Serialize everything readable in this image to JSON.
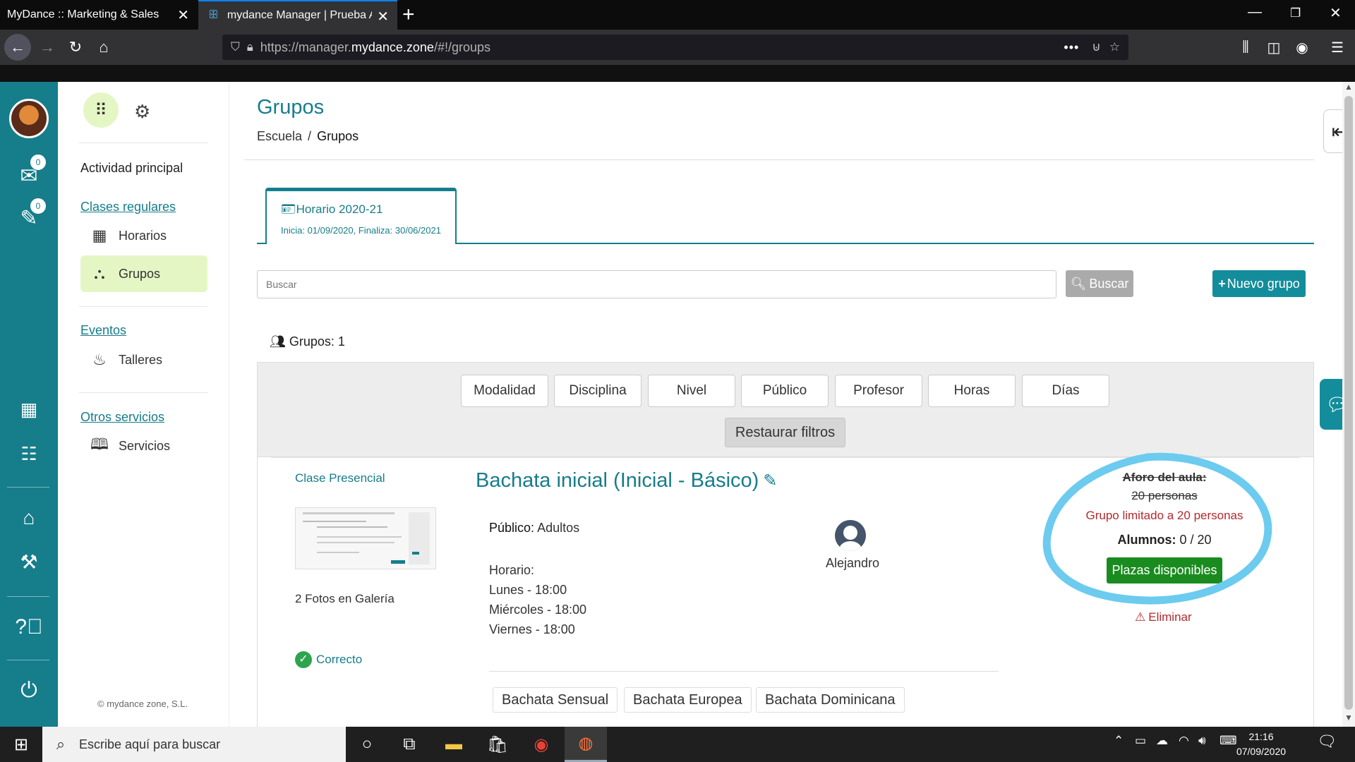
{
  "browser": {
    "tabs": [
      {
        "title": "MyDance :: Marketing & Sales"
      },
      {
        "title": "mydance Manager | Prueba Ale"
      }
    ],
    "url_prefix": "https://manager.",
    "url_domain": "mydance.zone",
    "url_path": "/#!/groups",
    "page_actions": "•••"
  },
  "rail": {
    "messages_badge": "0",
    "tasks_badge": "0"
  },
  "sidebar": {
    "main_heading": "Actividad principal",
    "sections": [
      {
        "title": "Clases regulares",
        "items": [
          "Horarios",
          "Grupos"
        ]
      },
      {
        "title": "Eventos",
        "items": [
          "Talleres"
        ]
      },
      {
        "title": "Otros servicios",
        "items": [
          "Servicios"
        ]
      }
    ],
    "copyright": "© mydance zone, S.L."
  },
  "header": {
    "title": "Grupos",
    "breadcrumb": {
      "root": "Escuela",
      "separator": "/",
      "current": "Grupos"
    }
  },
  "season_tab": {
    "title": "Horario 2020-21",
    "dates": "Inicia: 01/09/2020, Finaliza: 30/06/2021"
  },
  "search": {
    "placeholder": "Buscar",
    "button": "Buscar",
    "new_group": "Nuevo grupo"
  },
  "groups_count": "Grupos: 1",
  "filters": {
    "buttons": [
      "Modalidad",
      "Disciplina",
      "Nivel",
      "Público",
      "Profesor",
      "Horas",
      "Días"
    ],
    "reset": "Restaurar filtros"
  },
  "group": {
    "class_type": "Clase Presencial",
    "photos": "2 Fotos en Galería",
    "status": "Correcto",
    "name": "Bachata inicial (Inicial - Básico)",
    "publico_label": "Público:",
    "publico_value": "Adultos",
    "horario_label": "Horario:",
    "schedule": [
      "Lunes - 18:00",
      "Miércoles - 18:00",
      "Viernes - 18:00"
    ],
    "teacher": "Alejandro",
    "tags": [
      "Bachata Sensual",
      "Bachata Europea",
      "Bachata Dominicana"
    ],
    "capacity_label": "Aforo del aula:",
    "capacity_value": "20 personas",
    "capacity_limit": "Grupo limitado a 20 personas",
    "alumnos_label": "Alumnos:",
    "alumnos_value": "0 / 20",
    "availability": "Plazas disponibles",
    "delete": "Eliminar"
  },
  "taskbar": {
    "search_placeholder": "Escribe aquí para buscar",
    "time": "21:16",
    "date": "07/09/2020"
  },
  "colors": {
    "accent": "#167d8b",
    "highlight_green": "#e5f6c5",
    "danger": "#b5292d",
    "success": "#1a8c1f",
    "annotation": "#6ccbef"
  }
}
